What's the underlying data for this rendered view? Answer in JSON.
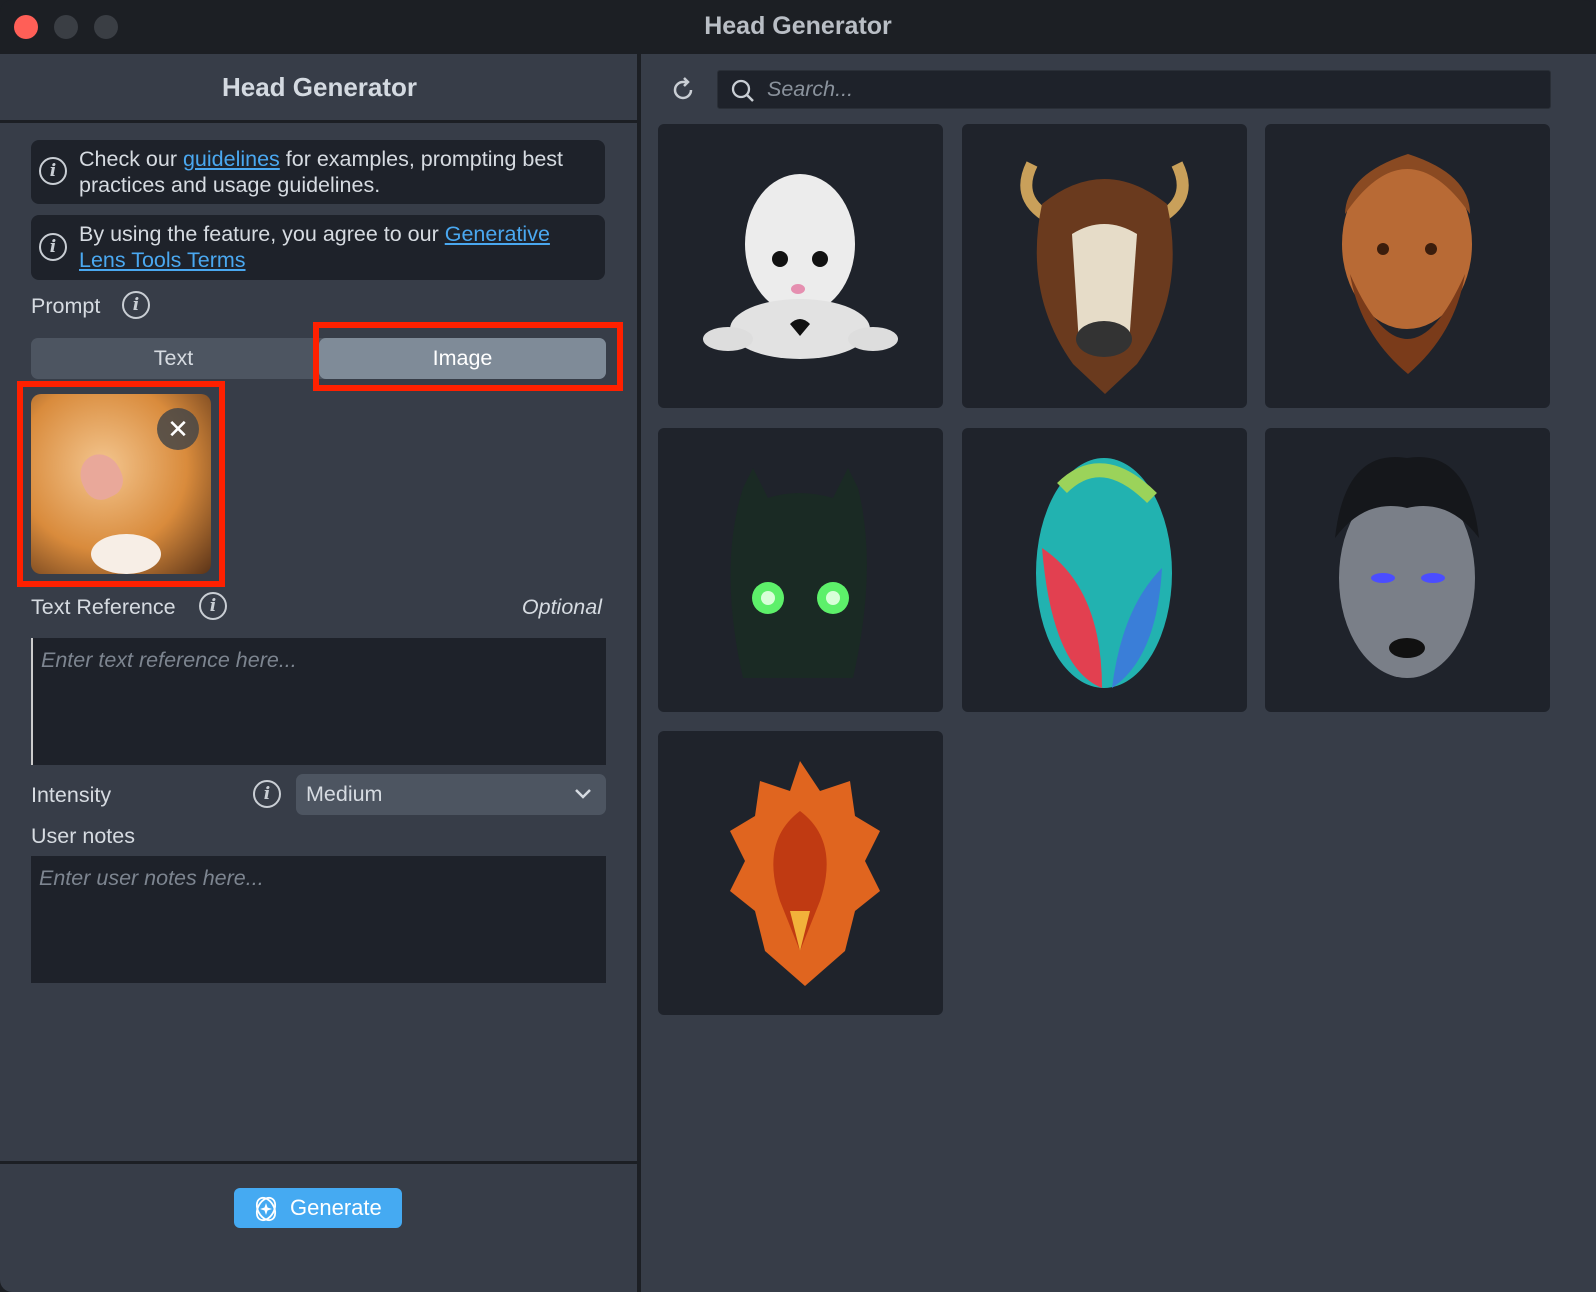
{
  "window": {
    "title": "Head Generator"
  },
  "left_panel": {
    "title": "Head Generator",
    "info1": {
      "prefix": "Check our ",
      "link": "guidelines",
      "suffix": " for examples, prompting best practices and usage guidelines."
    },
    "info2": {
      "prefix": "By using the feature, you agree to our ",
      "link": "Generative Lens Tools Terms"
    },
    "prompt_label": "Prompt",
    "tabs": [
      {
        "label": "Text",
        "selected": false
      },
      {
        "label": "Image",
        "selected": true
      }
    ],
    "text_reference_label": "Text Reference",
    "optional_label": "Optional",
    "text_reference_placeholder": "Enter text reference here...",
    "intensity_label": "Intensity",
    "intensity_value": "Medium",
    "user_notes_label": "User notes",
    "user_notes_placeholder": "Enter user notes here...",
    "generate_label": "Generate"
  },
  "right_panel": {
    "search_placeholder": "Search...",
    "results": [
      "ghost-plush-head",
      "bison-head",
      "bronze-bearded-man-head",
      "dark-green-eyed-mask",
      "feathered-parrot-head",
      "grey-woman-head",
      "fire-phoenix-head"
    ]
  },
  "colors": {
    "accent": "#45aaf2",
    "link": "#4aa8f0",
    "highlight": "#ff2000",
    "close": "#ff5f57"
  }
}
